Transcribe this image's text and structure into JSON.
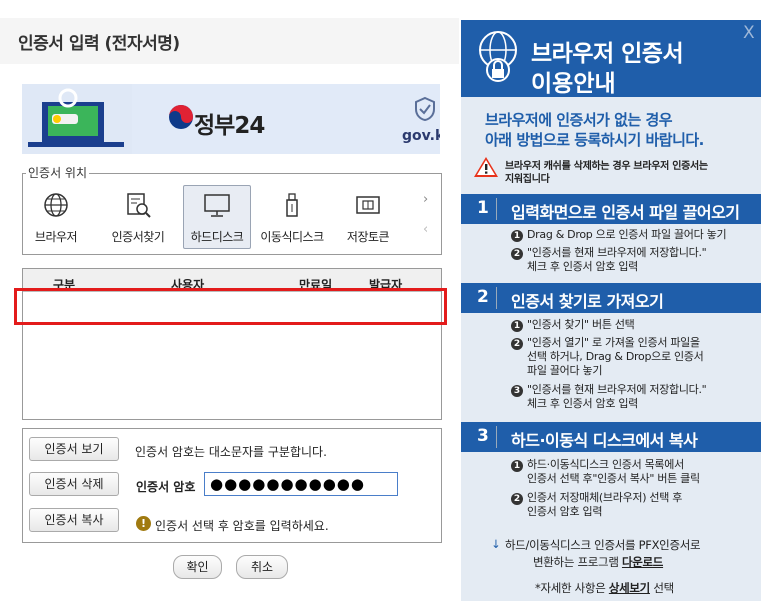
{
  "dialog": {
    "title": "인증서 입력 (전자서명)",
    "banner": {
      "brand": "정부24",
      "domain": "gov.kr"
    },
    "location": {
      "legend": "인증서 위치",
      "items": [
        {
          "label": "브라우저",
          "icon": "globe-icon"
        },
        {
          "label": "인증서찾기",
          "icon": "certificate-search-icon"
        },
        {
          "label": "하드디스크",
          "icon": "monitor-icon",
          "selected": true
        },
        {
          "label": "이동식디스크",
          "icon": "usb-icon"
        },
        {
          "label": "저장토큰",
          "icon": "token-icon"
        }
      ]
    },
    "table": {
      "columns": [
        "구분",
        "사용자",
        "만료일",
        "발급자"
      ]
    },
    "actions": {
      "view_button": "인증서 보기",
      "delete_button": "인증서 삭제",
      "copy_button": "인증서 복사",
      "case_note": "인증서 암호는 대소문자를 구분합니다.",
      "password_label": "인증서 암호",
      "password_value": "●●●●●●●●●●●",
      "hint": "인증서 선택 후 암호를 입력하세요."
    },
    "confirm_button": "확인",
    "cancel_button": "취소"
  },
  "guide": {
    "title_line1": "브라우저 인증서",
    "title_line2": "이용안내",
    "intro_line1": "브라우저에 인증서가 없는 경우",
    "intro_line2": "아래 방법으로 등록하시기 바랍니다.",
    "warning_line1": "브라우저 캐쉬를 삭제하는 경우 브라우저 인증서는",
    "warning_line2": "지워집니다",
    "sections": [
      {
        "number": "1",
        "title": "입력화면으로 인증서 파일 끌어오기",
        "steps": [
          [
            "Drag & Drop 으로 인증서 파일 끌어다 놓기"
          ],
          [
            "\"인증서를 현재 브라우저에 저장합니다.\"",
            "체크 후 인증서 암호 입력"
          ]
        ]
      },
      {
        "number": "2",
        "title": "인증서 찾기로 가져오기",
        "steps": [
          [
            "\"인증서 찾기\" 버튼 선택"
          ],
          [
            "\"인증서 열기\" 로 가져올 인증서 파일을",
            "선택 하거나, Drag & Drop으로 인증서",
            "파일 끌어다 놓기"
          ],
          [
            "\"인증서를 현재 브라우저에 저장합니다.\"",
            "체크 후 인증서 암호 입력"
          ]
        ]
      },
      {
        "number": "3",
        "title": "하드·이동식 디스크에서 복사",
        "steps": [
          [
            "하드·이동식디스크 인증서 목록에서",
            "인증서 선택 후\"인증서 복사\" 버튼 클릭"
          ],
          [
            "인증서 저장매체(브라우저) 선택 후",
            "인증서 암호 입력"
          ]
        ]
      }
    ],
    "footer_line1": "하드/이동식디스크 인증서를 PFX인증서로",
    "footer_line2_pre": "변환하는 프로그램 ",
    "footer_line2_link": "다운로드",
    "footer_line3_pre": "*자세한 사항은 ",
    "footer_line3_link": "상세보기",
    "footer_line3_post": " 선택",
    "close": "X"
  }
}
